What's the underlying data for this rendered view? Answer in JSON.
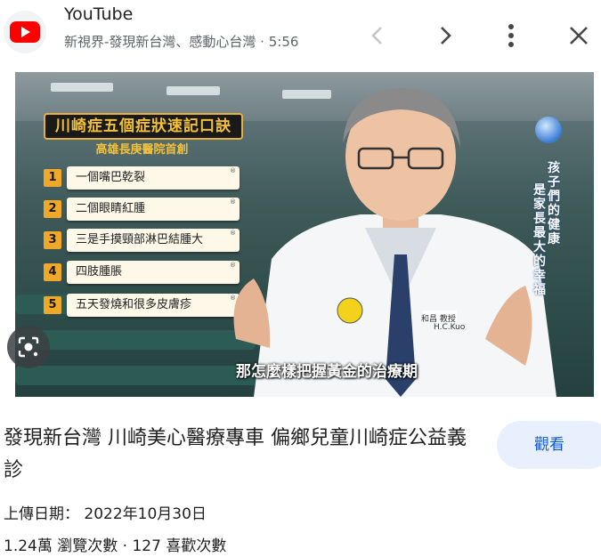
{
  "header": {
    "site_name": "YouTube",
    "subtitle": "新視界-發現新台灣、感動心台灣 · 5:56",
    "icons": [
      "youtube-logo-icon",
      "chevron-left-icon",
      "chevron-right-icon",
      "more-vert-icon",
      "close-icon"
    ]
  },
  "thumbnail": {
    "panel_title": "川崎症五個症狀速記口訣",
    "panel_subtitle": "高雄長庚醫院首創",
    "items": [
      {
        "num": "1",
        "text": "一個嘴巴乾裂"
      },
      {
        "num": "2",
        "text": "二個眼睛紅腫"
      },
      {
        "num": "3",
        "text": "三是手摸頸部淋巴結腫大"
      },
      {
        "num": "4",
        "text": "四肢腫脹"
      },
      {
        "num": "5",
        "text": "五天發燒和很多皮膚疹"
      }
    ],
    "caption": "那怎麼樣把握黃金的治療期",
    "side_text_1": "孩子們的健康",
    "side_text_2": "是家長最大的幸福",
    "badge_text": "H.C.Kuo",
    "badge_prefix": "和昌 教授"
  },
  "title": "發現新台灣 川崎美心醫療專車 偏鄉兒童川崎症公益義診",
  "visit_label": "觀看",
  "upload": "上傳日期： 2022年10月30日",
  "stats": "1.24萬 瀏覽次數 · 127 喜歡次數",
  "colors": {
    "accent": "#0b57d0",
    "visit_bg": "#e8f0fe",
    "youtube_red": "#ff0000",
    "panel_gold": "#f0a828"
  }
}
